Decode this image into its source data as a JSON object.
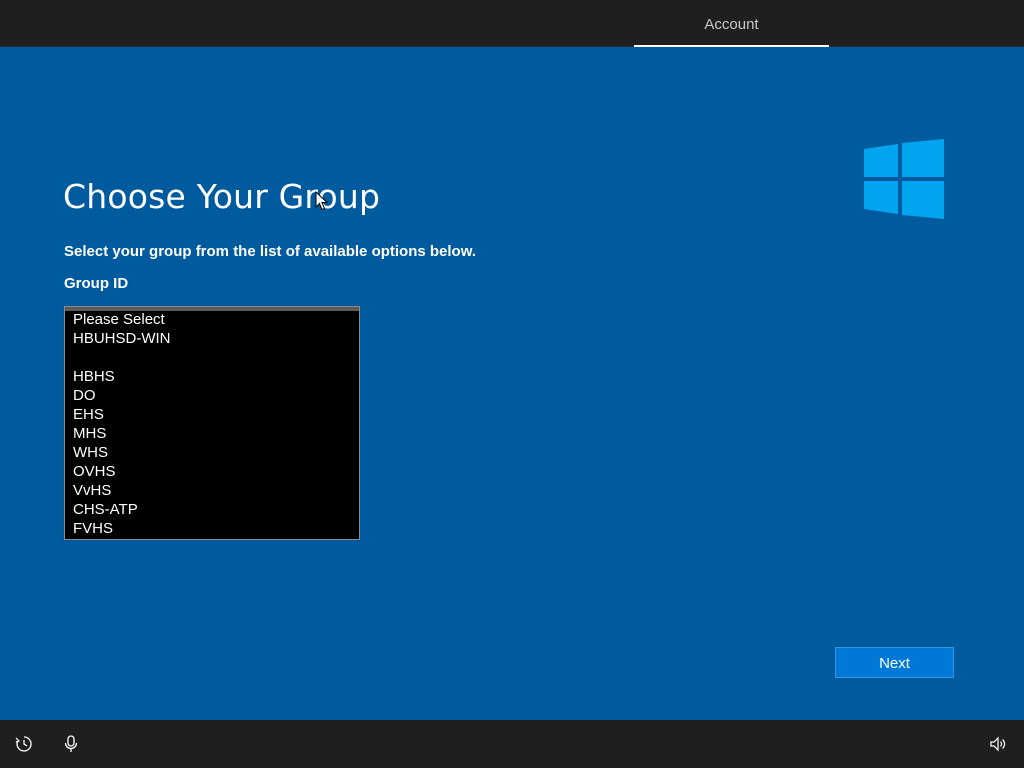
{
  "header": {
    "tab_label": "Account"
  },
  "main": {
    "title": "Choose Your Group",
    "subtitle": "Select your group from the list of available options below.",
    "field_label": "Group ID",
    "group_options": [
      "Please Select",
      "HBUHSD-WIN",
      "",
      "HBHS",
      "DO",
      "EHS",
      "MHS",
      "WHS",
      "OVHS",
      "VvHS",
      "CHS-ATP",
      "FVHS"
    ],
    "next_label": "Next"
  },
  "icons": {
    "logo": "windows-logo",
    "ease_of_access": "ease-of-access-icon",
    "microphone": "microphone-icon",
    "volume": "volume-icon",
    "cursor": "mouse-pointer"
  },
  "colors": {
    "background": "#005a9e",
    "bars": "#1f1f1f",
    "logo": "#00a4ef",
    "button": "#0078d7"
  }
}
